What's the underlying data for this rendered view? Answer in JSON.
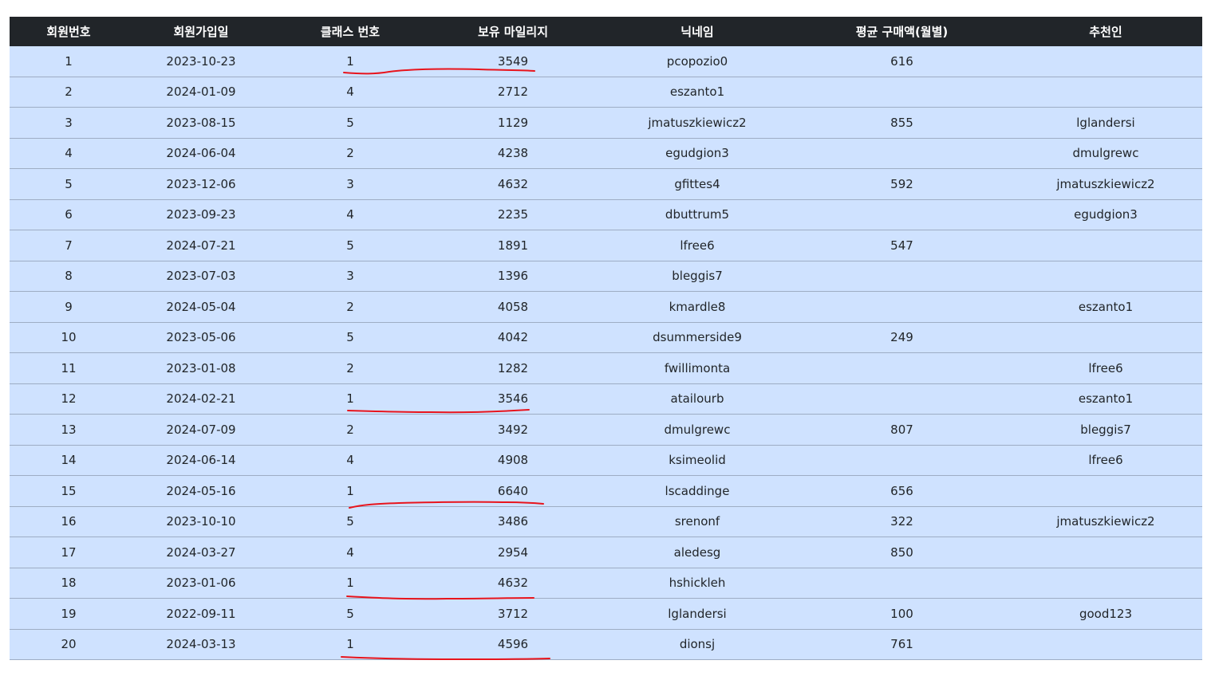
{
  "table": {
    "headers": [
      "회원번호",
      "회원가입일",
      "클래스 번호",
      "보유 마일리지",
      "닉네임",
      "평균 구매액(월별)",
      "추천인"
    ],
    "rows": [
      [
        "1",
        "2023-10-23",
        "1",
        "3549",
        "pcopozio0",
        "616",
        ""
      ],
      [
        "2",
        "2024-01-09",
        "4",
        "2712",
        "eszanto1",
        "",
        ""
      ],
      [
        "3",
        "2023-08-15",
        "5",
        "1129",
        "jmatuszkiewicz2",
        "855",
        "lglandersi"
      ],
      [
        "4",
        "2024-06-04",
        "2",
        "4238",
        "egudgion3",
        "",
        "dmulgrewc"
      ],
      [
        "5",
        "2023-12-06",
        "3",
        "4632",
        "gfittes4",
        "592",
        "jmatuszkiewicz2"
      ],
      [
        "6",
        "2023-09-23",
        "4",
        "2235",
        "dbuttrum5",
        "",
        "egudgion3"
      ],
      [
        "7",
        "2024-07-21",
        "5",
        "1891",
        "lfree6",
        "547",
        ""
      ],
      [
        "8",
        "2023-07-03",
        "3",
        "1396",
        "bleggis7",
        "",
        ""
      ],
      [
        "9",
        "2024-05-04",
        "2",
        "4058",
        "kmardle8",
        "",
        "eszanto1"
      ],
      [
        "10",
        "2023-05-06",
        "5",
        "4042",
        "dsummerside9",
        "249",
        ""
      ],
      [
        "11",
        "2023-01-08",
        "2",
        "1282",
        "fwillimonta",
        "",
        "lfree6"
      ],
      [
        "12",
        "2024-02-21",
        "1",
        "3546",
        "atailourb",
        "",
        "eszanto1"
      ],
      [
        "13",
        "2024-07-09",
        "2",
        "3492",
        "dmulgrewc",
        "807",
        "bleggis7"
      ],
      [
        "14",
        "2024-06-14",
        "4",
        "4908",
        "ksimeolid",
        "",
        "lfree6"
      ],
      [
        "15",
        "2024-05-16",
        "1",
        "6640",
        "lscaddinge",
        "656",
        ""
      ],
      [
        "16",
        "2023-10-10",
        "5",
        "3486",
        "srenonf",
        "322",
        "jmatuszkiewicz2"
      ],
      [
        "17",
        "2024-03-27",
        "4",
        "2954",
        "aledesg",
        "850",
        ""
      ],
      [
        "18",
        "2023-01-06",
        "1",
        "4632",
        "hshickleh",
        "",
        ""
      ],
      [
        "19",
        "2022-09-11",
        "5",
        "3712",
        "lglandersi",
        "100",
        "good123"
      ],
      [
        "20",
        "2024-03-13",
        "1",
        "4596",
        "dionsj",
        "761",
        ""
      ]
    ]
  },
  "colors": {
    "header_bg": "#212529",
    "row_bg": "#cfe2ff",
    "annotation": "#e8141c"
  }
}
